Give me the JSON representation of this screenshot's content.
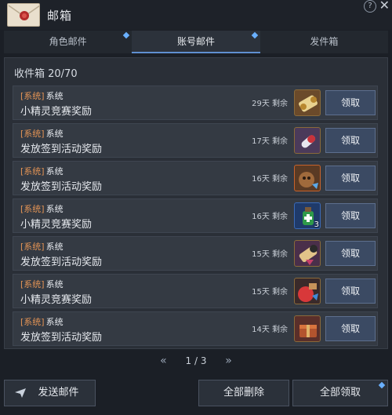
{
  "window": {
    "title": "邮箱"
  },
  "tabs": [
    {
      "label": "角色邮件",
      "has_new": true
    },
    {
      "label": "账号邮件",
      "has_new": true
    },
    {
      "label": "发件箱",
      "has_new": false
    }
  ],
  "inbox": {
    "label": "收件箱 20/70"
  },
  "mails": [
    {
      "tag": "[系统]",
      "sender": "系统",
      "subject": "小精灵竞赛奖励",
      "days_left": "29天 剩余",
      "item_icon": "scroll-icon",
      "qty": "",
      "claim": "领取"
    },
    {
      "tag": "[系统]",
      "sender": "系统",
      "subject": "发放签到活动奖励",
      "days_left": "17天 剩余",
      "item_icon": "capsule-icon",
      "qty": "",
      "claim": "领取"
    },
    {
      "tag": "[系统]",
      "sender": "系统",
      "subject": "发放签到活动奖励",
      "days_left": "16天 剩余",
      "item_icon": "squirrel-pet-icon",
      "qty": "",
      "claim": "领取"
    },
    {
      "tag": "[系统]",
      "sender": "系统",
      "subject": "小精灵竞赛奖励",
      "days_left": "16天 剩余",
      "item_icon": "potion-icon",
      "qty": "3",
      "claim": "领取"
    },
    {
      "tag": "[系统]",
      "sender": "系统",
      "subject": "发放签到活动奖励",
      "days_left": "15天 剩余",
      "item_icon": "scroll-icon",
      "qty": "",
      "claim": "领取"
    },
    {
      "tag": "[系统]",
      "sender": "系统",
      "subject": "小精灵竞赛奖励",
      "days_left": "15天 剩余",
      "item_icon": "pouch-icon",
      "qty": "",
      "claim": "领取"
    },
    {
      "tag": "[系统]",
      "sender": "系统",
      "subject": "发放签到活动奖励",
      "days_left": "14天 剩余",
      "item_icon": "chest-icon",
      "qty": "",
      "claim": "领取"
    }
  ],
  "pager": {
    "prev": "«",
    "page": "1 / 3",
    "next": "»"
  },
  "footer": {
    "send_label": "发送邮件",
    "delete_all_label": "全部删除",
    "claim_all_label": "全部领取"
  }
}
